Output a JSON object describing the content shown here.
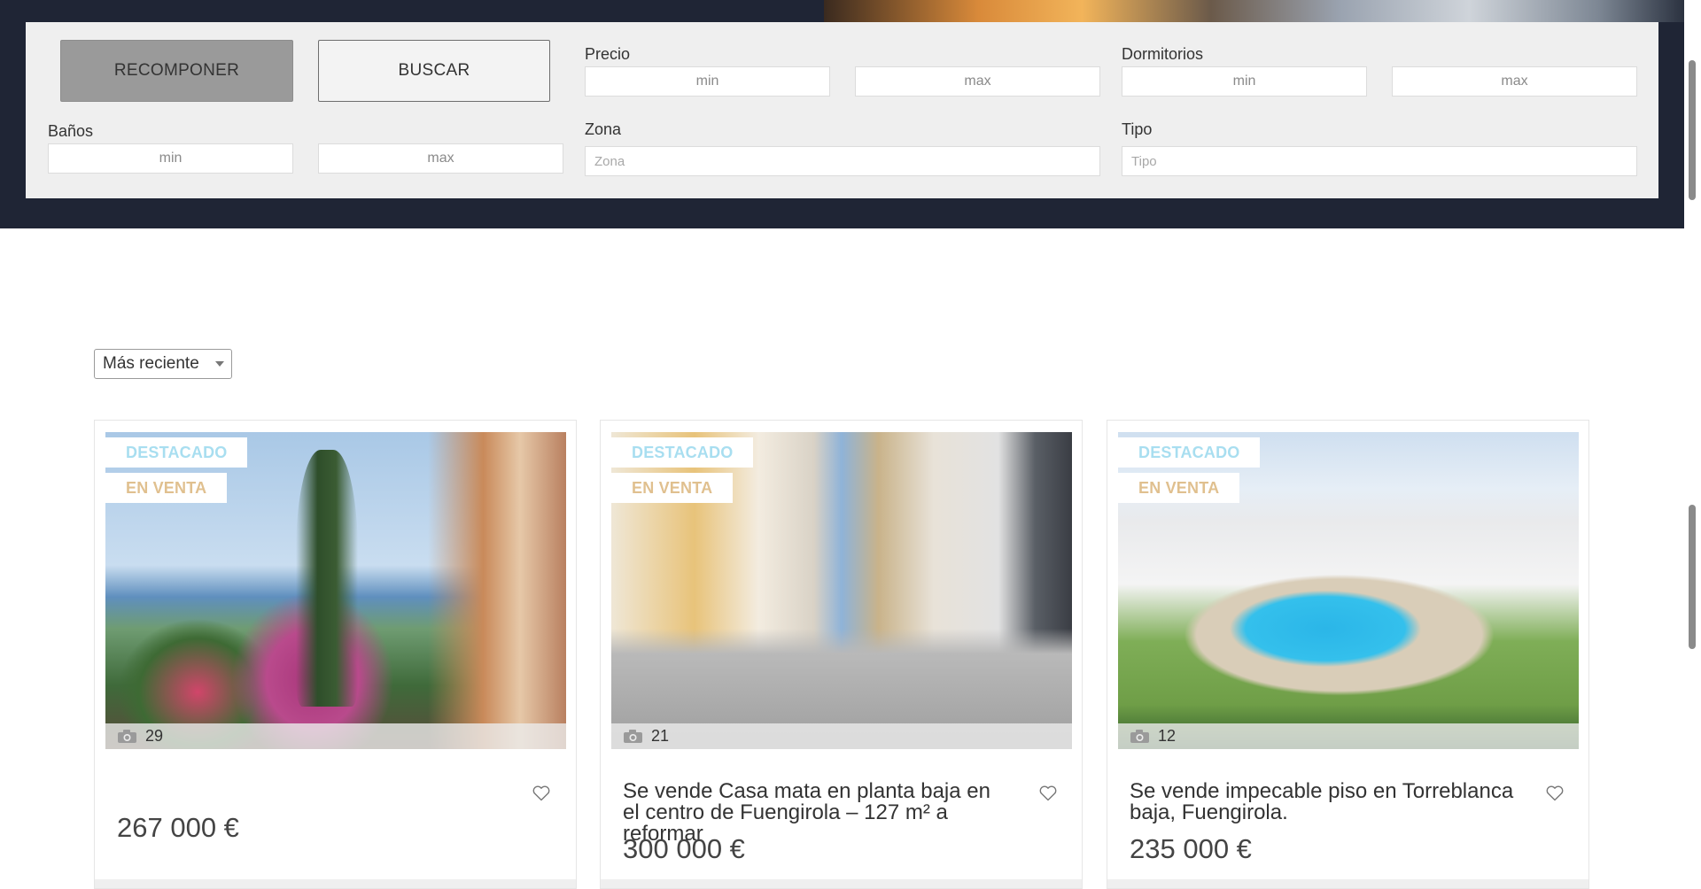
{
  "search": {
    "reset_label": "RECOMPONER",
    "search_label": "BUSCAR",
    "price_label": "Precio",
    "bedrooms_label": "Dormitorios",
    "bathrooms_label": "Baños",
    "zone_label": "Zona",
    "type_label": "Tipo",
    "min_placeholder": "min",
    "max_placeholder": "max",
    "zone_placeholder": "Zona",
    "type_placeholder": "Tipo"
  },
  "sort": {
    "selected": "Más reciente"
  },
  "listings": [
    {
      "featured_label": "DESTACADO",
      "status_label": "EN VENTA",
      "photo_count": "29",
      "title": "",
      "price": "267 000 €"
    },
    {
      "featured_label": "DESTACADO",
      "status_label": "EN VENTA",
      "photo_count": "21",
      "title": "Se vende Casa mata en planta baja en el centro de Fuengirola – 127 m² a reformar",
      "price": "300 000 €"
    },
    {
      "featured_label": "DESTACADO",
      "status_label": "EN VENTA",
      "photo_count": "12",
      "title": "Se vende impecable piso en Torreblanca baja, Fuengirola.",
      "price": "235 000 €"
    }
  ],
  "icons": {
    "photo_count": "camera-icon",
    "favorite": "heart-icon",
    "dropdown": "caret-down-icon"
  },
  "colors": {
    "header_band": "#1f2535",
    "featured_tag": "#a8def0",
    "sale_tag": "#e0c08f",
    "reset_button": "#9a9a9a"
  }
}
